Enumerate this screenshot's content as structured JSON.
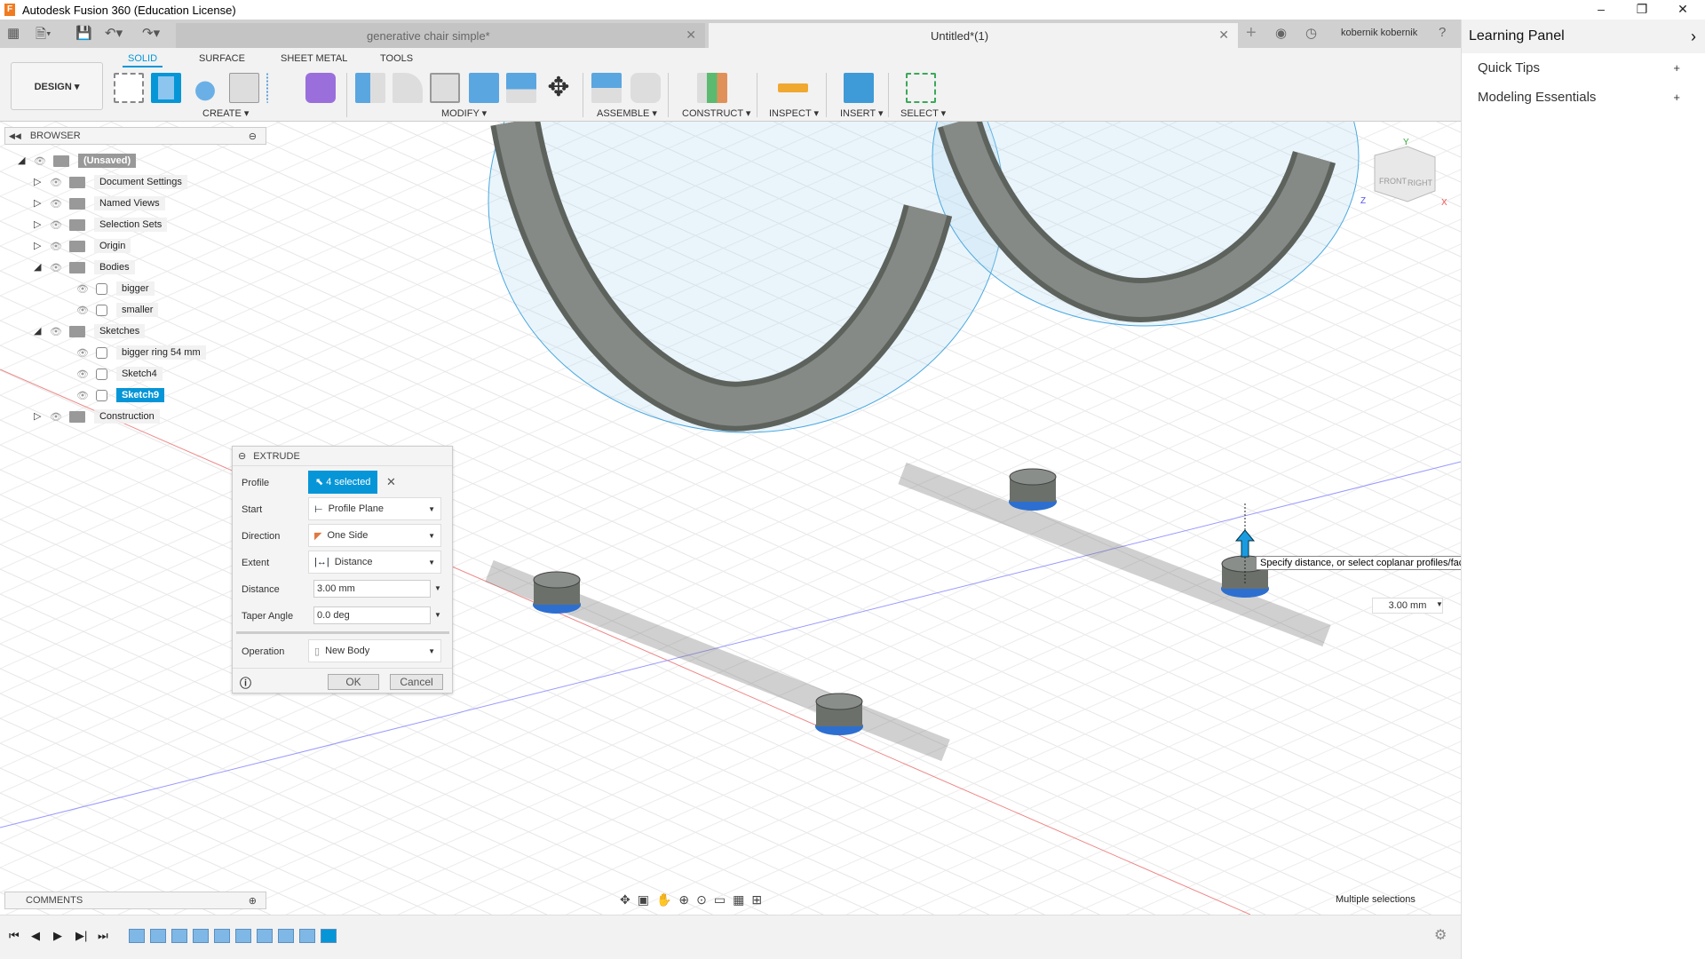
{
  "window": {
    "title": "Autodesk Fusion 360 (Education License)",
    "minimize": "–",
    "restore": "❐",
    "close": "✕"
  },
  "tabs": [
    {
      "label": "generative chair simple*",
      "active": false
    },
    {
      "label": "Untitled*(1)",
      "active": true
    }
  ],
  "user": "kobernik kobernik",
  "toolbar": {
    "workspace": "DESIGN ▾",
    "tabs": [
      "SOLID",
      "SURFACE",
      "SHEET METAL",
      "TOOLS"
    ],
    "groups": [
      "CREATE ▾",
      "MODIFY ▾",
      "ASSEMBLE ▾",
      "CONSTRUCT ▾",
      "INSPECT ▾",
      "INSERT ▾",
      "SELECT ▾"
    ]
  },
  "browser": {
    "title": "BROWSER",
    "items": [
      {
        "label": "(Unsaved)",
        "level": 0
      },
      {
        "label": "Document Settings",
        "level": 1
      },
      {
        "label": "Named Views",
        "level": 1
      },
      {
        "label": "Selection Sets",
        "level": 1
      },
      {
        "label": "Origin",
        "level": 1
      },
      {
        "label": "Bodies",
        "level": 1
      },
      {
        "label": "bigger",
        "level": 2
      },
      {
        "label": "smaller",
        "level": 2
      },
      {
        "label": "Sketches",
        "level": 1
      },
      {
        "label": "bigger ring 54 mm",
        "level": 2
      },
      {
        "label": "Sketch4",
        "level": 2
      },
      {
        "label": "Sketch9",
        "level": 2,
        "selected": true
      },
      {
        "label": "Construction",
        "level": 1
      }
    ]
  },
  "extrude": {
    "title": "EXTRUDE",
    "profile_label": "Profile",
    "profile_value": "4 selected",
    "start_label": "Start",
    "start_value": "Profile Plane",
    "direction_label": "Direction",
    "direction_value": "One Side",
    "extent_label": "Extent",
    "extent_value": "Distance",
    "distance_label": "Distance",
    "distance_value": "3.00 mm",
    "taper_label": "Taper Angle",
    "taper_value": "0.0 deg",
    "operation_label": "Operation",
    "operation_value": "New Body",
    "ok": "OK",
    "cancel": "Cancel"
  },
  "viewport": {
    "tooltip": "Specify distance, or select coplanar profiles/faces to modify the selection",
    "distance_value": "3.00 mm",
    "viewcube": {
      "front": "FRONT",
      "right": "RIGHT",
      "x": "X",
      "y": "Y",
      "z": "Z"
    }
  },
  "comments": "COMMENTS",
  "status": "Multiple selections",
  "learning": {
    "title": "Learning Panel",
    "items": [
      "Quick Tips",
      "Modeling Essentials"
    ]
  },
  "colors": {
    "accent": "#0696d7",
    "body": "#7b7f7b",
    "sketch": "#4aa8e0",
    "x_axis": "#e05050",
    "z_axis": "#6a6ae0"
  }
}
